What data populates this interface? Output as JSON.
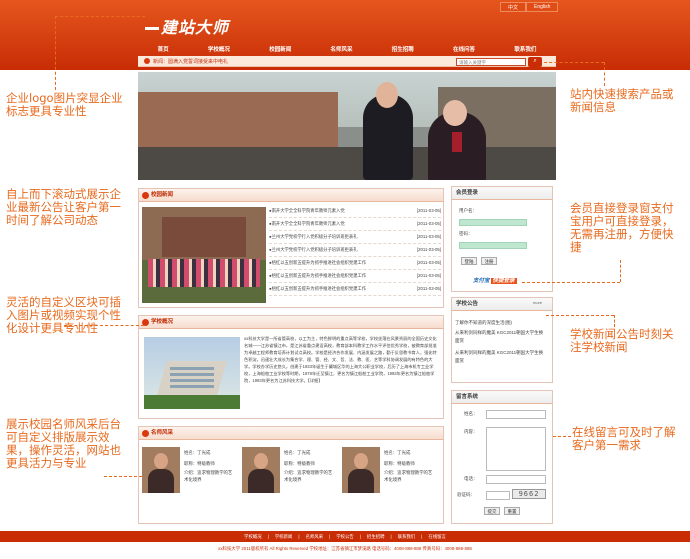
{
  "header": {
    "langs": [
      "中文",
      "English"
    ],
    "logo": "建站大师",
    "nav": [
      "首页",
      "学校概况",
      "校园新闻",
      "名师风采",
      "招生招聘",
      "在线问答",
      "联系我们"
    ]
  },
  "newsbar": {
    "label": "新闻：",
    "text": "圆满入党誓词接受来中电礼"
  },
  "search": {
    "placeholder": "请输入关键字"
  },
  "news_panel": {
    "title": "校园新闻",
    "items": [
      {
        "text": "●南开大学全全科学院青年教师元素入党",
        "date": "[2011-03-05]"
      },
      {
        "text": "●南开大学全全科学院青年教师元素入党",
        "date": "[2011-03-05]"
      },
      {
        "text": "●兰州大学党校学行入党积极分子培训班拒表礼",
        "date": "[2011-03-05]"
      },
      {
        "text": "●兰州大学党校学行入党积极分子培训班拒表礼",
        "date": "[2011-03-05]"
      },
      {
        "text": "●梧红以五创新五提升为抓手推进社会组织党建工作",
        "date": "[2011-03-05]"
      },
      {
        "text": "●梧红以五创新五提升为抓手推进社会组织党建工作",
        "date": "[2011-03-05]"
      },
      {
        "text": "●梧红以五创新五提升为抓手推进社会组织党建工作",
        "date": "[2011-03-05]"
      }
    ]
  },
  "about_panel": {
    "title": "学校概况",
    "text": "xx科技大学是一所省管高校，以工为主，特色鲜明的重点高等学校，学校坐落在风景秀丽的全国历史文化名城——江苏省镇江市，是江苏省重点建设高校，教育部本科教学工作水平评估优秀学校，被教育部批准为卓越工程师教育培养计划试点高校。学校是经济合作发展、内涵发展之路，勤于反思教书育人，强化特色积淀，迅速壮大成长为集合学、理、管、经、文、哲、法、教、医、艺等学科协调发展的有特色的大学。学校办学历史悠久，创建于1933年诞生于冀城区华的上海大公职业学校，后历了上海市机专工业学校，上海船舶工业学校等时期，1978年迁至镇江，更名为镇江船舶工业学院，1993年更名为镇江船舶学院，1993年更名为江苏科技大学。【详细】"
  },
  "teachers_panel": {
    "title": "名师风采",
    "items": [
      {
        "name": "姓名：丁光成",
        "title": "职称：特级教师",
        "intro": "介绍：追求物理教学的艺术化境界"
      },
      {
        "name": "姓名：丁光成",
        "title": "职称：特级教师",
        "intro": "介绍：追求物理教学的艺术化境界"
      },
      {
        "name": "姓名：丁光成",
        "title": "职称：特级教师",
        "intro": "介绍：追求物理教学的艺术化境界"
      }
    ]
  },
  "login_panel": {
    "title": "会员登录",
    "user_label": "用户名：",
    "pass_label": "密码：",
    "login_btn": "登陆",
    "register_btn": "注册",
    "alipay": "支付宝",
    "alipay_tag": "快捷登录"
  },
  "notice_panel": {
    "title": "学校公告",
    "more": "more",
    "items": [
      "了解你不知道的深度生活(图)",
      "从来利剑同样的魔美 KGC2011朝国大学生换面赏",
      "从来利剑同样的魔美 KGC2011朝国大学生换面赏"
    ]
  },
  "message_panel": {
    "title": "留言系统",
    "name_label": "姓名：",
    "content_label": "内容：",
    "phone_label": "电话：",
    "captcha_label": "验证码：",
    "captcha": "9662",
    "submit_btn": "提交",
    "reset_btn": "重置"
  },
  "annotations": {
    "logo": "企业logo图片突显企业标志更具专业性",
    "search": "站内快速搜索产品或新闻信息",
    "scroll": "自上而下滚动式展示企业最新公告让客户第一时间了解公司动态",
    "login": "会员直接登录窗支付宝用户可直接登录，无需再注册，方便快捷",
    "custom": "灵活的自定义区块可插入图片或视频实现个性化设计更具专业性",
    "notice": "学校新闻公告时刻关注学校新闻",
    "teacher": "展示校园名师风采后台可自定义排版展示效果，操作灵活，网站也更具活力与专业",
    "message": "在线留言可及时了解客户第一需求"
  },
  "footer": {
    "nav": [
      "学校概况",
      "|",
      "学校新闻",
      "|",
      "名师风采",
      "|",
      "学校公告",
      "|",
      "招生招聘",
      "|",
      "联系我们",
      "|",
      "在线留言"
    ],
    "info": "xx科技大学 2011版权所有 All Rights Reserved 学校地址：江苏省镇江市梦溪路   电话号码：4008-888-888   传真号码：4008-888-888"
  },
  "colors": {
    "brand": "#d8380c",
    "annotation": "#e86a1e"
  }
}
